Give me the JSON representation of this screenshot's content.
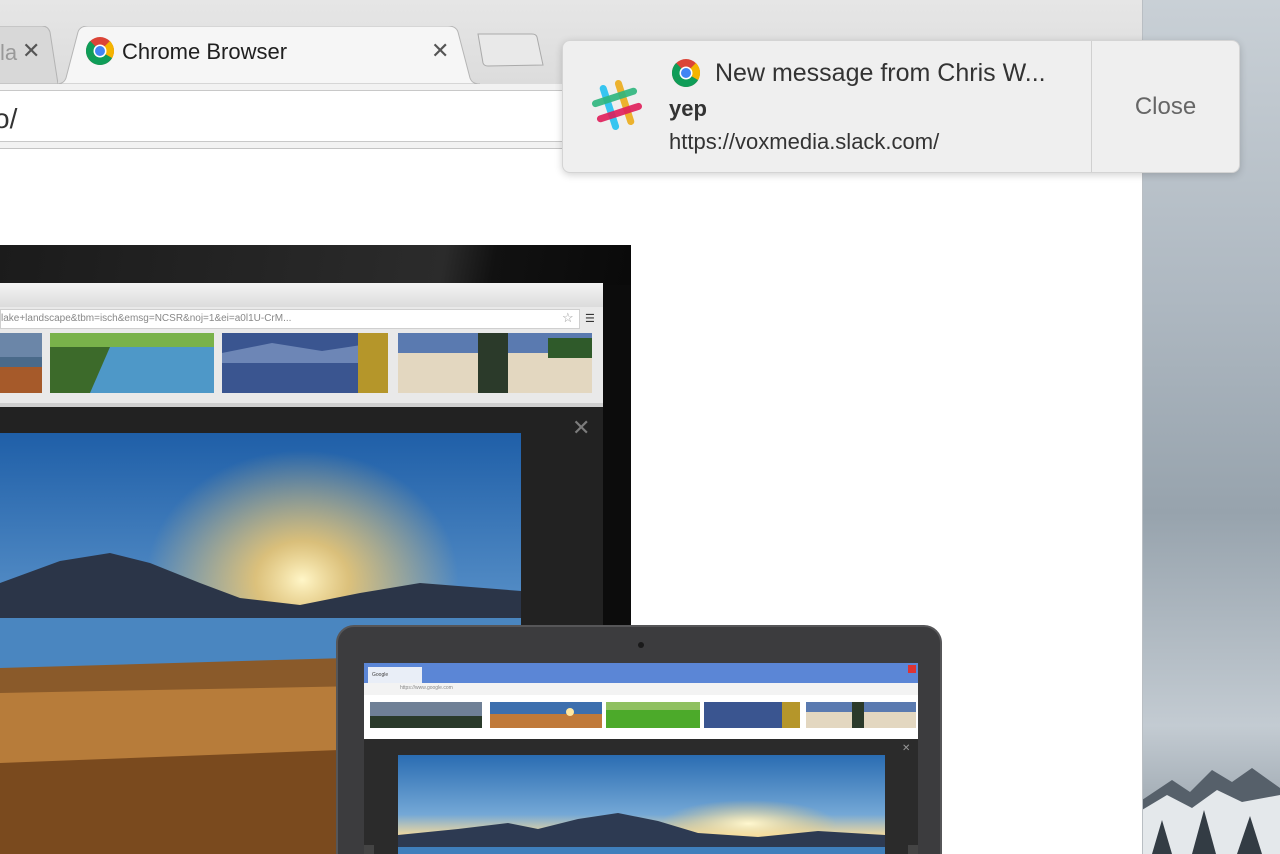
{
  "browser": {
    "tabs": [
      {
        "label": "la",
        "active": false
      },
      {
        "label": "Chrome Browser",
        "active": true
      }
    ],
    "tab_close_glyph": "✕",
    "address_partial": "o/"
  },
  "content": {
    "monitor_url_text": "lake+landscape&tbm=isch&emsg=NCSR&noj=1&ei=a0l1U-CrM...",
    "laptop_tab_label": "Google",
    "laptop_url_text": "https://www.google.com"
  },
  "notification": {
    "title": "New message from Chris W...",
    "body": "yep",
    "origin": "https://voxmedia.slack.com/",
    "close_label": "Close"
  },
  "colors": {
    "notification_bg": "#efefef",
    "slack_yellow": "#ecb22e",
    "slack_blue": "#36c5f0",
    "slack_green": "#2eb67d",
    "slack_pink": "#e01e5a"
  }
}
